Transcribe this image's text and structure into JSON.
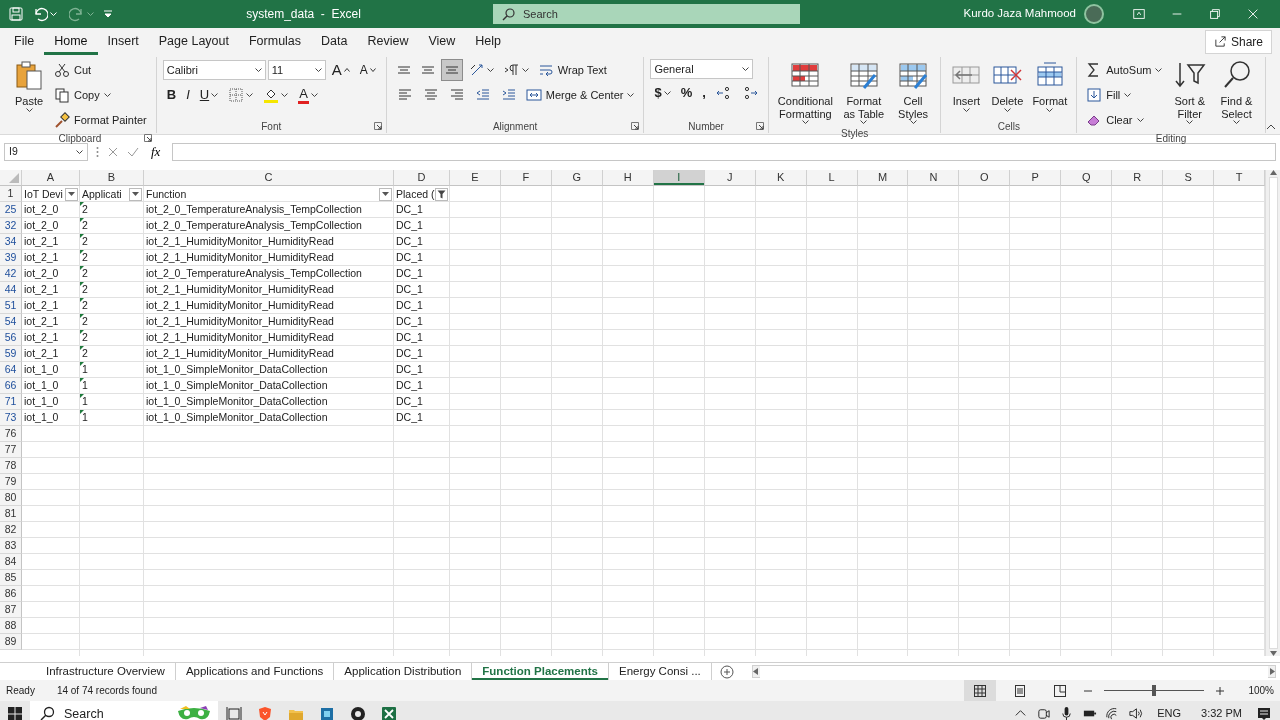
{
  "title_bar": {
    "title": "system_data  -  Excel",
    "search_placeholder": "Search",
    "user": "Kurdo Jaza Mahmood"
  },
  "menu_tabs": [
    {
      "label": "File",
      "selected": false
    },
    {
      "label": "Home",
      "selected": true
    },
    {
      "label": "Insert",
      "selected": false
    },
    {
      "label": "Page Layout",
      "selected": false
    },
    {
      "label": "Formulas",
      "selected": false
    },
    {
      "label": "Data",
      "selected": false
    },
    {
      "label": "Review",
      "selected": false
    },
    {
      "label": "View",
      "selected": false
    },
    {
      "label": "Help",
      "selected": false
    }
  ],
  "share": "Share",
  "ribbon": [
    {
      "label": "Clipboard",
      "launcher": true,
      "parts": [
        {
          "kind": "large",
          "label": "Paste",
          "dropdown": true
        },
        {
          "kind": "stack",
          "lines": [
            [
              {
                "kind": "small",
                "label": "Cut"
              }
            ],
            [
              {
                "kind": "small",
                "label": "Copy",
                "dropdown": true
              }
            ],
            [
              {
                "kind": "small",
                "label": "Format Painter"
              }
            ]
          ]
        }
      ]
    },
    {
      "label": "Font",
      "launcher": true,
      "parts": [
        {
          "kind": "stack",
          "lines": [
            [
              {
                "kind": "field",
                "value": "Calibri"
              },
              {
                "kind": "field",
                "value": "11"
              },
              {
                "kind": "grow",
                "label": "A"
              },
              {
                "kind": "shrink",
                "label": "A"
              }
            ],
            [
              {
                "kind": "bold",
                "label": "B"
              },
              {
                "kind": "italic",
                "label": "I"
              },
              {
                "kind": "underline",
                "label": "U",
                "dropdown": true
              },
              {
                "kind": "icon",
                "dropdown": true
              },
              {
                "kind": "icon",
                "dropdown": true
              },
              {
                "kind": "fontcolor",
                "label": "A",
                "dropdown": true
              }
            ]
          ]
        }
      ]
    },
    {
      "label": "Alignment",
      "launcher": true,
      "parts": [
        {
          "kind": "stack",
          "lines": [
            [
              {
                "kind": "icon",
                "selected": false
              },
              {
                "kind": "icon",
                "selected": false
              },
              {
                "kind": "icon",
                "selected": true
              },
              {
                "kind": "icon",
                "dropdown": true
              },
              {
                "kind": "icon",
                "dropdown": true
              },
              {
                "kind": "small",
                "label": "Wrap Text"
              }
            ],
            [
              {
                "kind": "icon",
                "selected": false
              },
              {
                "kind": "icon",
                "selected": false
              },
              {
                "kind": "icon",
                "selected": false
              },
              {
                "kind": "icon"
              },
              {
                "kind": "icon"
              },
              {
                "kind": "small",
                "label": "Merge & Center",
                "dropdown": true
              }
            ]
          ]
        }
      ]
    },
    {
      "label": "Number",
      "launcher": true,
      "parts": [
        {
          "kind": "stack",
          "lines": [
            [
              {
                "kind": "field",
                "value": "General"
              }
            ],
            [
              {
                "kind": "glyph",
                "label": "$",
                "dropdown": true
              },
              {
                "kind": "glyph",
                "label": "%"
              },
              {
                "kind": "glyph",
                "label": ","
              },
              {
                "kind": "icon"
              },
              {
                "kind": "icon"
              }
            ]
          ]
        }
      ]
    },
    {
      "label": "Styles",
      "launcher": false,
      "parts": [
        {
          "kind": "large",
          "label": "Conditional Formatting",
          "dropdown": true
        },
        {
          "kind": "large",
          "label": "Format as Table",
          "dropdown": true
        },
        {
          "kind": "large",
          "label": "Cell Styles",
          "dropdown": true
        }
      ]
    },
    {
      "label": "Cells",
      "launcher": false,
      "parts": [
        {
          "kind": "large",
          "label": "Insert",
          "dropdown": true
        },
        {
          "kind": "large",
          "label": "Delete",
          "dropdown": true
        },
        {
          "kind": "large",
          "label": "Format",
          "dropdown": true
        }
      ]
    },
    {
      "label": "Editing",
      "launcher": false,
      "parts": [
        {
          "kind": "stack",
          "lines": [
            [
              {
                "kind": "small",
                "label": "AutoSum",
                "dropdown": true
              }
            ],
            [
              {
                "kind": "small",
                "label": "Fill",
                "dropdown": true
              }
            ],
            [
              {
                "kind": "small",
                "label": "Clear",
                "dropdown": true
              }
            ]
          ]
        },
        {
          "kind": "large",
          "label": "Sort & Filter",
          "dropdown": true
        },
        {
          "kind": "large",
          "label": "Find & Select",
          "dropdown": true
        }
      ]
    }
  ],
  "formula_bar": {
    "name_box": "I9",
    "function_label": "fx"
  },
  "sheet": {
    "columns": [
      {
        "label": "A",
        "selected": false
      },
      {
        "label": "B",
        "selected": false
      },
      {
        "label": "C",
        "selected": false
      },
      {
        "label": "D",
        "selected": false
      },
      {
        "label": "E",
        "selected": false
      },
      {
        "label": "F",
        "selected": false
      },
      {
        "label": "G",
        "selected": false
      },
      {
        "label": "H",
        "selected": false
      },
      {
        "label": "I",
        "selected": true
      },
      {
        "label": "J",
        "selected": false
      },
      {
        "label": "K",
        "selected": false
      },
      {
        "label": "L",
        "selected": false
      },
      {
        "label": "M",
        "selected": false
      },
      {
        "label": "N",
        "selected": false
      },
      {
        "label": "O",
        "selected": false
      },
      {
        "label": "P",
        "selected": false
      },
      {
        "label": "Q",
        "selected": false
      },
      {
        "label": "R",
        "selected": false
      },
      {
        "label": "S",
        "selected": false
      },
      {
        "label": "T",
        "selected": false
      }
    ],
    "header_row": {
      "row": "1",
      "cells": [
        {
          "text": "IoT Devi",
          "filtered": false
        },
        {
          "text": "Applicati",
          "filtered": false
        },
        {
          "text": "Function",
          "filtered": false
        },
        {
          "text": "Placed (",
          "filtered": true
        }
      ]
    },
    "rows": [
      {
        "row": "25",
        "flagged": true,
        "cells": [
          "iot_2_0",
          "2",
          "iot_2_0_TemperatureAnalysis_TempCollection",
          "DC_1"
        ]
      },
      {
        "row": "32",
        "flagged": true,
        "cells": [
          "iot_2_0",
          "2",
          "iot_2_0_TemperatureAnalysis_TempCollection",
          "DC_1"
        ]
      },
      {
        "row": "34",
        "flagged": true,
        "cells": [
          "iot_2_1",
          "2",
          "iot_2_1_HumidityMonitor_HumidityRead",
          "DC_1"
        ]
      },
      {
        "row": "39",
        "flagged": true,
        "cells": [
          "iot_2_1",
          "2",
          "iot_2_1_HumidityMonitor_HumidityRead",
          "DC_1"
        ]
      },
      {
        "row": "42",
        "flagged": true,
        "cells": [
          "iot_2_0",
          "2",
          "iot_2_0_TemperatureAnalysis_TempCollection",
          "DC_1"
        ]
      },
      {
        "row": "44",
        "flagged": true,
        "cells": [
          "iot_2_1",
          "2",
          "iot_2_1_HumidityMonitor_HumidityRead",
          "DC_1"
        ]
      },
      {
        "row": "51",
        "flagged": true,
        "cells": [
          "iot_2_1",
          "2",
          "iot_2_1_HumidityMonitor_HumidityRead",
          "DC_1"
        ]
      },
      {
        "row": "54",
        "flagged": true,
        "cells": [
          "iot_2_1",
          "2",
          "iot_2_1_HumidityMonitor_HumidityRead",
          "DC_1"
        ]
      },
      {
        "row": "56",
        "flagged": true,
        "cells": [
          "iot_2_1",
          "2",
          "iot_2_1_HumidityMonitor_HumidityRead",
          "DC_1"
        ]
      },
      {
        "row": "59",
        "flagged": true,
        "cells": [
          "iot_2_1",
          "2",
          "iot_2_1_HumidityMonitor_HumidityRead",
          "DC_1"
        ]
      },
      {
        "row": "64",
        "flagged": true,
        "cells": [
          "iot_1_0",
          "1",
          "iot_1_0_SimpleMonitor_DataCollection",
          "DC_1"
        ]
      },
      {
        "row": "66",
        "flagged": true,
        "cells": [
          "iot_1_0",
          "1",
          "iot_1_0_SimpleMonitor_DataCollection",
          "DC_1"
        ]
      },
      {
        "row": "71",
        "flagged": true,
        "cells": [
          "iot_1_0",
          "1",
          "iot_1_0_SimpleMonitor_DataCollection",
          "DC_1"
        ]
      },
      {
        "row": "73",
        "flagged": true,
        "cells": [
          "iot_1_0",
          "1",
          "iot_1_0_SimpleMonitor_DataCollection",
          "DC_1"
        ]
      }
    ],
    "empty_rows": [
      "76",
      "77",
      "78",
      "79",
      "80",
      "81",
      "82",
      "83",
      "84",
      "85",
      "86",
      "87",
      "88",
      "89"
    ]
  },
  "sheet_tabs": [
    {
      "label": "Infrastructure Overview",
      "selected": false
    },
    {
      "label": "Applications and Functions",
      "selected": false
    },
    {
      "label": "Application Distribution",
      "selected": false
    },
    {
      "label": "Function Placements",
      "selected": true
    },
    {
      "label": "Energy Consi ...",
      "selected": false
    }
  ],
  "status_bar": {
    "mode": "Ready",
    "message": "14 of 74 records found",
    "zoom": {
      "level": 0.5,
      "reading": "100%"
    }
  },
  "taskbar": {
    "search_placeholder": "Search",
    "language": "ENG",
    "time": "3:32 PM"
  }
}
